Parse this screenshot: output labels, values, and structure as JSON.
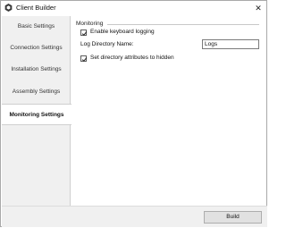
{
  "window": {
    "title": "Client Builder",
    "close_glyph": "✕"
  },
  "sidebar": {
    "items": [
      {
        "label": "Basic Settings",
        "selected": false
      },
      {
        "label": "Connection Settings",
        "selected": false
      },
      {
        "label": "Installation Settings",
        "selected": false
      },
      {
        "label": "Assembly Settings",
        "selected": false
      },
      {
        "label": "Monitoring Settings",
        "selected": true
      }
    ]
  },
  "monitoring": {
    "group_title": "Monitoring",
    "enable_keyboard_logging": {
      "label": "Enable keyboard logging",
      "checked": true
    },
    "log_directory": {
      "label": "Log Directory Name:",
      "value": "Logs"
    },
    "hidden_attributes": {
      "label": "Set directory attributes to hidden",
      "checked": true
    }
  },
  "footer": {
    "build_label": "Build"
  },
  "colors": {
    "sidebar_bg": "#f0f0f0",
    "selected_bg": "#ffffff",
    "footer_bg": "#f0f0f0",
    "button_bg": "#e1e1e1"
  },
  "icons": {
    "app": "app-logo-icon",
    "close": "close-icon",
    "check": "checkmark-icon"
  }
}
